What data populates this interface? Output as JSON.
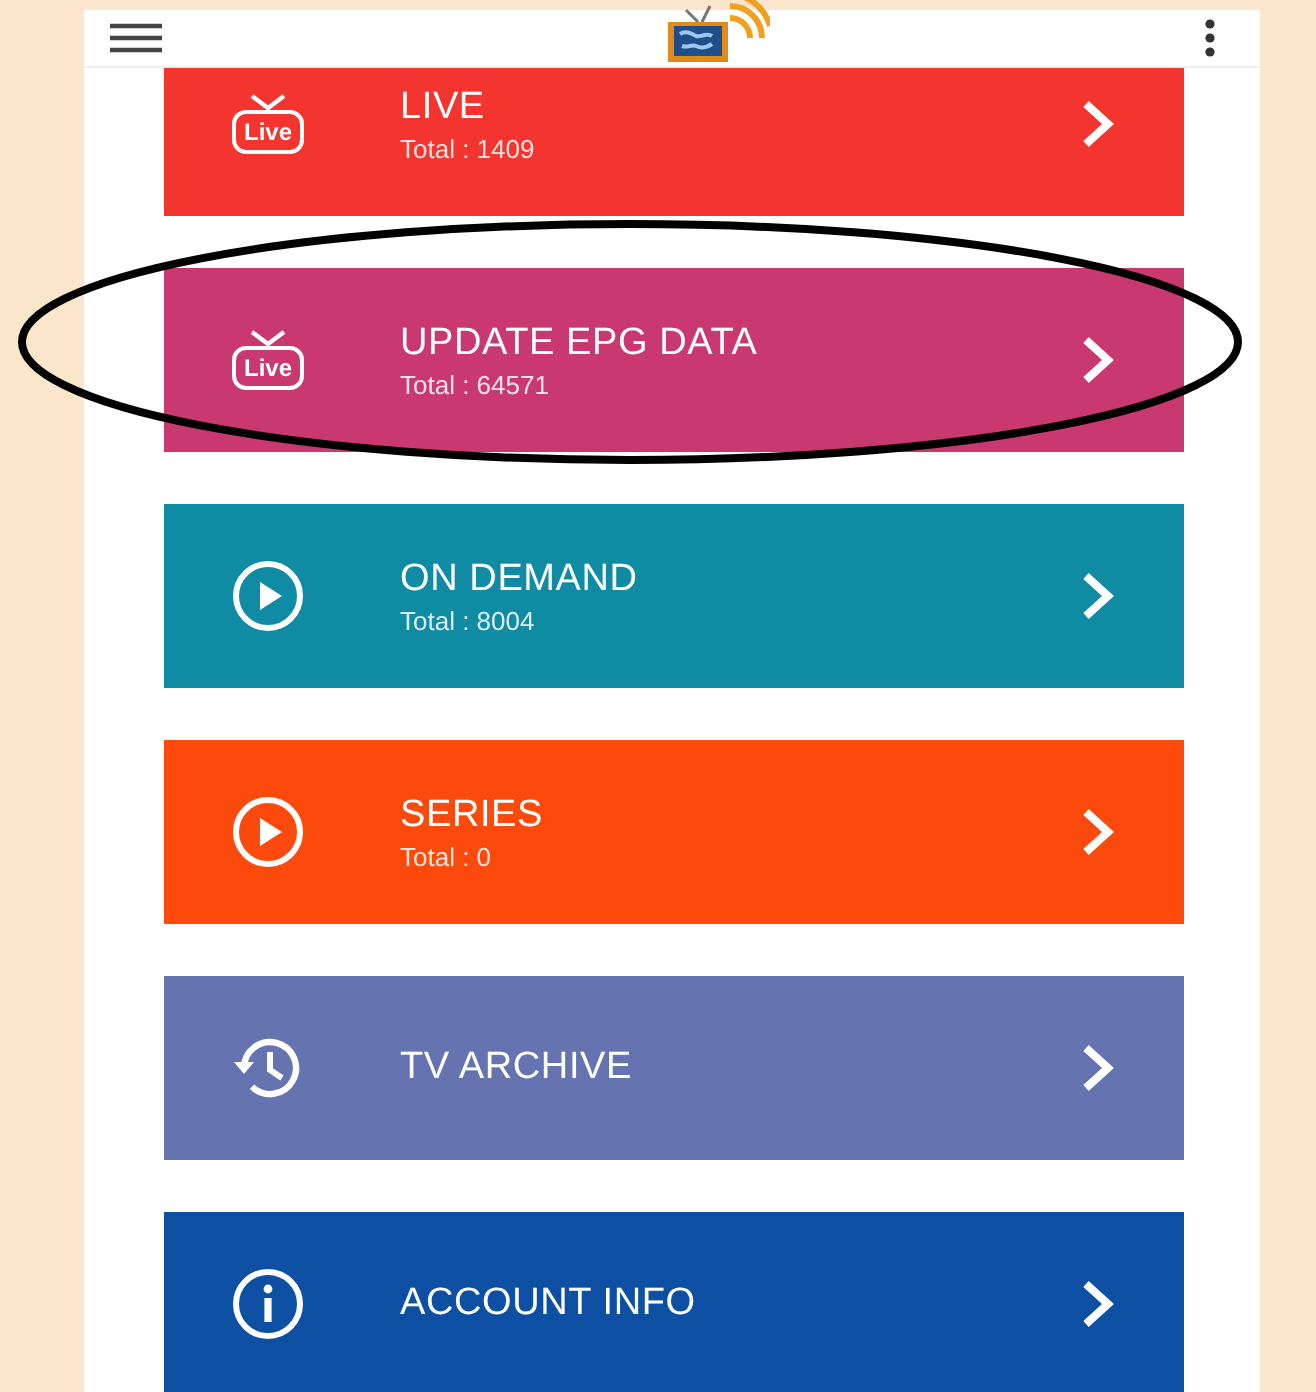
{
  "menu_items": [
    {
      "title": "LIVE",
      "subtitle": "Total : 1409",
      "kind": "live",
      "icon_label": "Live",
      "color": "#f4342e",
      "circled": false
    },
    {
      "title": "UPDATE EPG DATA",
      "subtitle": "Total : 64571",
      "kind": "live",
      "icon_label": "Live",
      "color": "#c9386f",
      "circled": true
    },
    {
      "title": "ON DEMAND",
      "subtitle": "Total : 8004",
      "kind": "play",
      "color": "#0f8ca3",
      "circled": false
    },
    {
      "title": "SERIES",
      "subtitle": "Total : 0",
      "kind": "play",
      "color": "#fb4a0c",
      "circled": false
    },
    {
      "title": "TV ARCHIVE",
      "kind": "history",
      "color": "#6574b0",
      "circled": false
    },
    {
      "title": "ACCOUNT INFO",
      "kind": "info",
      "color": "#0d4fa3",
      "circled": false
    }
  ]
}
